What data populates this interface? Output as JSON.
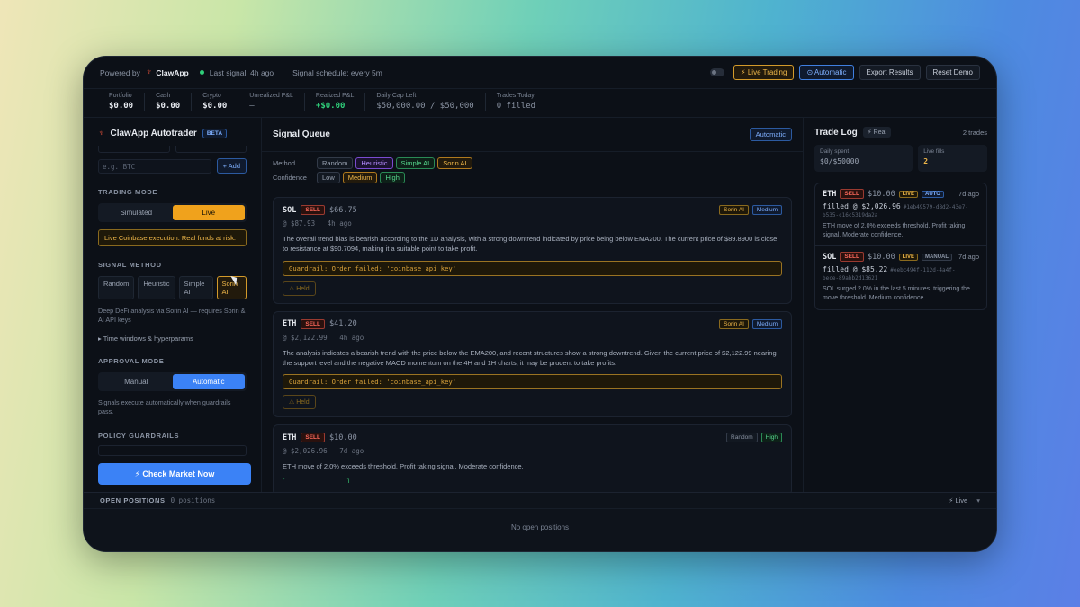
{
  "topbar": {
    "powered_by": "Powered by",
    "brand": "ClawApp",
    "last_signal": "Last signal: 4h ago",
    "schedule": "Signal schedule: every 5m",
    "live_trading": "⚡ Live Trading",
    "automatic": "⊙ Automatic",
    "export": "Export Results",
    "reset": "Reset Demo"
  },
  "stats": [
    {
      "label": "Portfolio",
      "value": "$0.00"
    },
    {
      "label": "Cash",
      "value": "$0.00"
    },
    {
      "label": "Crypto",
      "value": "$0.00"
    },
    {
      "label": "Unrealized P&L",
      "value": "—"
    },
    {
      "label": "Realized P&L",
      "value": "+$0.00"
    },
    {
      "label": "Daily Cap Left",
      "value": "$50,000.00 / $50,000"
    },
    {
      "label": "Trades Today",
      "value": "0 filled"
    }
  ],
  "sidebar": {
    "title": "ClawApp Autotrader",
    "beta": "BETA",
    "add_placeholder": "e.g. BTC",
    "add_btn": "+ Add",
    "trading_mode_label": "TRADING MODE",
    "simulated": "Simulated",
    "live": "Live",
    "live_warning": "Live Coinbase execution. Real funds at risk.",
    "signal_method_label": "SIGNAL METHOD",
    "methods": [
      "Random",
      "Heuristic",
      "Simple AI",
      "Sorin AI"
    ],
    "method_desc": "Deep DeFi analysis via Sorin AI — requires Sorin & AI API keys",
    "time_windows": "▸ Time windows & hyperparams",
    "approval_label": "APPROVAL MODE",
    "manual": "Manual",
    "automatic": "Automatic",
    "approval_desc": "Signals execute automatically when guardrails pass.",
    "policy_label": "POLICY GUARDRAILS",
    "check_market": "⚡ Check Market Now"
  },
  "queue": {
    "title": "Signal Queue",
    "badge": "Automatic",
    "method_label": "Method",
    "methods": [
      "Random",
      "Heuristic",
      "Simple AI",
      "Sorin AI"
    ],
    "confidence_label": "Confidence",
    "confidences": [
      "Low",
      "Medium",
      "High"
    ],
    "cards": [
      {
        "symbol": "SOL",
        "side": "SELL",
        "amount": "$66.75",
        "tag1": "Sorin AI",
        "tag2": "Medium",
        "price": "@ $87.93",
        "ago": "4h ago",
        "text": "The overall trend bias is bearish according to the 1D analysis, with a strong downtrend indicated by price being below EMA200. The current price of $89.8900 is close to resistance at $90.7094, making it a suitable point to take profit.",
        "guard": "Guardrail: Order failed: 'coinbase_api_key'",
        "held": "⚠ Held"
      },
      {
        "symbol": "ETH",
        "side": "SELL",
        "amount": "$41.20",
        "tag1": "Sorin AI",
        "tag2": "Medium",
        "price": "@ $2,122.99",
        "ago": "4h ago",
        "text": "The analysis indicates a bearish trend with the price below the EMA200, and recent structures show a strong downtrend. Given the current price of $2,122.99 nearing the support level and the negative MACD momentum on the 4H and 1H charts, it may be prudent to take profits.",
        "guard": "Guardrail: Order failed: 'coinbase_api_key'",
        "held": "⚠ Held"
      },
      {
        "symbol": "ETH",
        "side": "SELL",
        "amount": "$10.00",
        "tag1": "Random",
        "tag2": "High",
        "price": "@ $2,026.96",
        "ago": "7d ago",
        "text": "ETH move of 2.0% exceeds threshold. Profit taking signal. Moderate confidence."
      }
    ]
  },
  "tradelog": {
    "title": "Trade Log",
    "real": "⚡ Real",
    "count": "2 trades",
    "daily_spent_label": "Daily spent",
    "daily_spent": "$0/$50000",
    "live_fills_label": "Live fills",
    "live_fills": "2",
    "trades": [
      {
        "symbol": "ETH",
        "side": "SELL",
        "amount": "$10.00",
        "b1": "LIVE",
        "b2": "AUTO",
        "ago": "7d ago",
        "fill": "filled @ $2,026.96",
        "hash": "#1eb49579-d8d2-43e7-",
        "hash2": "b535-c16c5319da2a",
        "text": "ETH move of 2.0% exceeds threshold. Profit taking signal. Moderate confidence."
      },
      {
        "symbol": "SOL",
        "side": "SELL",
        "amount": "$10.00",
        "b1": "LIVE",
        "b2": "MANUAL",
        "ago": "7d ago",
        "fill": "filled @ $85.22",
        "hash": "#eebc494f-112d-4a4f-",
        "hash2": "bece-89abb2d13621",
        "text": "SOL surged 2.0% in the last 5 minutes, triggering the move threshold. Medium confidence."
      }
    ]
  },
  "positions": {
    "title": "OPEN POSITIONS",
    "count": "0 positions",
    "live": "⚡ Live",
    "caret": "▾",
    "empty": "No open positions"
  }
}
